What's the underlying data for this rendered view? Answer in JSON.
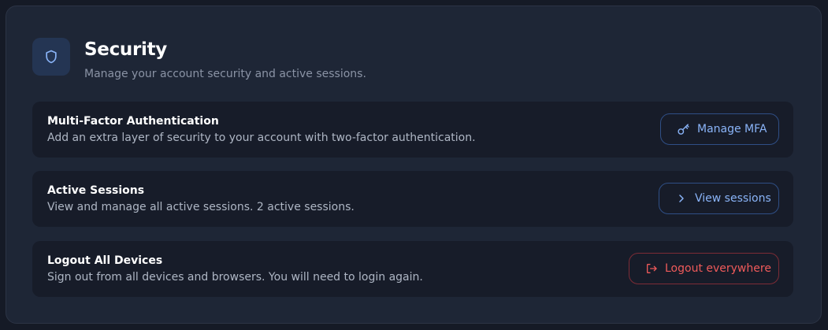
{
  "header": {
    "icon": "shield-icon",
    "title": "Security",
    "subtitle": "Manage your account security and active sessions."
  },
  "rows": [
    {
      "title": "Multi-Factor Authentication",
      "description": "Add an extra layer of security to your account with two-factor authentication.",
      "button_label": "Manage MFA",
      "button_icon": "key-icon"
    },
    {
      "title": "Active Sessions",
      "description": "View and manage all active sessions. 2 active sessions.",
      "button_label": "View sessions",
      "button_icon": "chevron-right-icon"
    },
    {
      "title": "Logout All Devices",
      "description": "Sign out from all devices and browsers. You will need to login again.",
      "button_label": "Logout everywhere",
      "button_icon": "logout-icon"
    }
  ],
  "colors": {
    "accent": "#8ab4f8",
    "danger": "#ef5a5a",
    "card_bg": "#1e2636",
    "row_bg": "#171c29"
  }
}
